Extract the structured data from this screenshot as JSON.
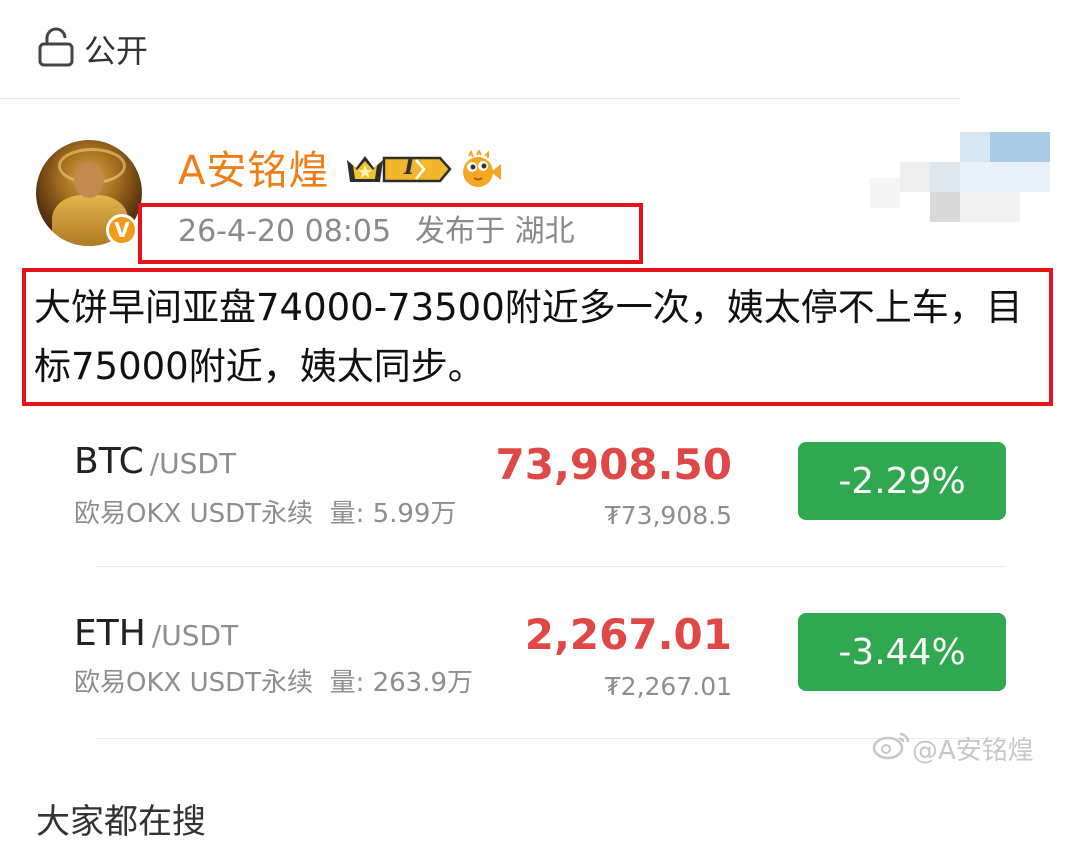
{
  "visibility": {
    "label": "公开",
    "icon": "lock-open-icon"
  },
  "post": {
    "author": "A安铭煌",
    "verified_mark": "V",
    "level_badge": "I",
    "timestamp": "26-4-20 08:05",
    "location": "发布于 湖北",
    "text": "大饼早间亚盘74000-73500附近多一次，姨太停不上车，目标75000附近，姨太同步。"
  },
  "markets": [
    {
      "symbol": "BTC",
      "pair": "/USDT",
      "source": "欧易OKX USDT永续",
      "volume": "量: 5.99万",
      "price": "73,908.50",
      "fiat_price": "₮73,908.5",
      "change": "-2.29%"
    },
    {
      "symbol": "ETH",
      "pair": "/USDT",
      "source": "欧易OKX USDT永续",
      "volume": "量: 263.9万",
      "price": "2,267.01",
      "fiat_price": "₮2,267.01",
      "change": "-3.44%"
    }
  ],
  "watermark": "@A安铭煌",
  "section_title": "大家都在搜",
  "colors": {
    "username": "#f07e17",
    "price": "#e04848",
    "change_bg": "#2fa84f",
    "highlight_box": "#e5141b"
  }
}
